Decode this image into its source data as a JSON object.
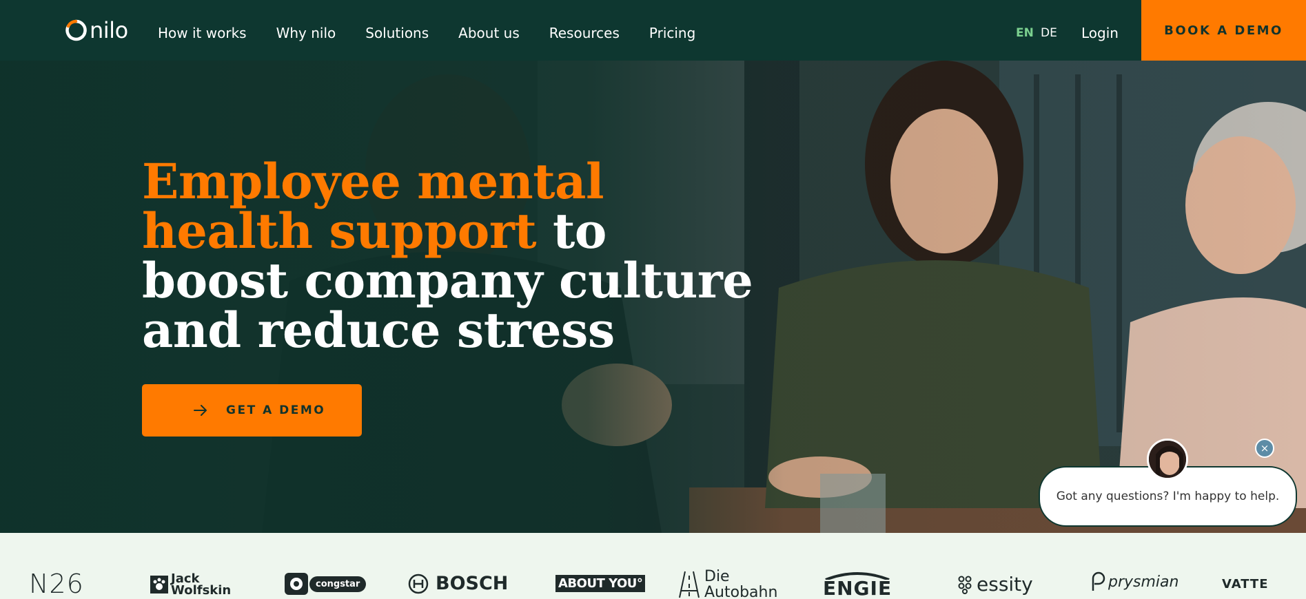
{
  "nav": {
    "brand": "nilo",
    "links": [
      "How it works",
      "Why nilo",
      "Solutions",
      "About us",
      "Resources",
      "Pricing"
    ],
    "lang_en": "EN",
    "lang_de": "DE",
    "login": "Login",
    "book_demo": "BOOK A DEMO"
  },
  "hero": {
    "headline_accent": "Employee mental health support",
    "headline_rest": " to boost company culture and reduce stress",
    "cta_label": "GET A DEMO"
  },
  "chat": {
    "message": "Got any questions? I'm happy to help.",
    "close": "×"
  },
  "logos": {
    "n26": "N26",
    "jack_line1": "Jack",
    "jack_line2": "Wolfskin",
    "congstar": "congstar",
    "bosch": "BOSCH",
    "aboutyou": "ABOUT YOU°",
    "autobahn_line1": "Die",
    "autobahn_line2": "Autobahn",
    "engie": "ENGIE",
    "essity": "essity",
    "prysmian": "prysmian",
    "vattenfall": "VATTE"
  },
  "colors": {
    "nav_bg": "#0e3730",
    "accent": "#ff7a00",
    "lang_active": "#7bd08f",
    "logos_bg": "#eef6ee"
  }
}
